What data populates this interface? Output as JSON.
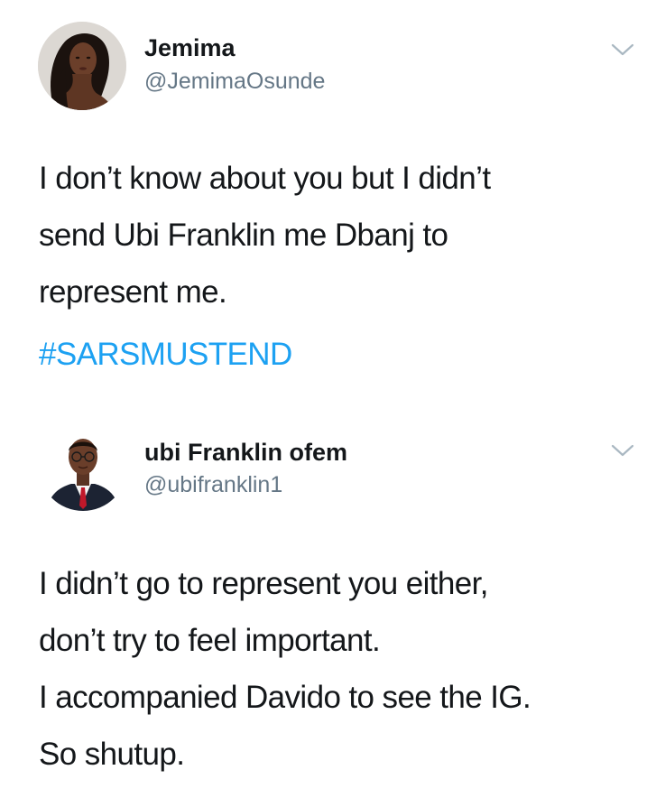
{
  "tweets": [
    {
      "author": {
        "name": "Jemima",
        "handle": "@JemimaOsunde",
        "avatar_icon": "profile-photo-woman"
      },
      "menu_icon": "chevron-down-icon",
      "text_lines": [
        "I don’t know about you but I didn’t",
        "send Ubi Franklin me Dbanj to",
        "represent me."
      ],
      "hashtag": "#SARSMUSTEND"
    },
    {
      "author": {
        "name": "ubi Franklin ofem",
        "handle": "@ubifranklin1",
        "avatar_icon": "profile-photo-man"
      },
      "menu_icon": "chevron-down-icon",
      "text_lines": [
        "I didn’t go to represent you either,",
        "don’t try to feel important.",
        "I accompanied Davido to see the IG.",
        "So shutup."
      ]
    }
  ],
  "colors": {
    "text": "#14171a",
    "secondary": "#657786",
    "link": "#1da1f2",
    "chevron": "#aab8c2"
  }
}
